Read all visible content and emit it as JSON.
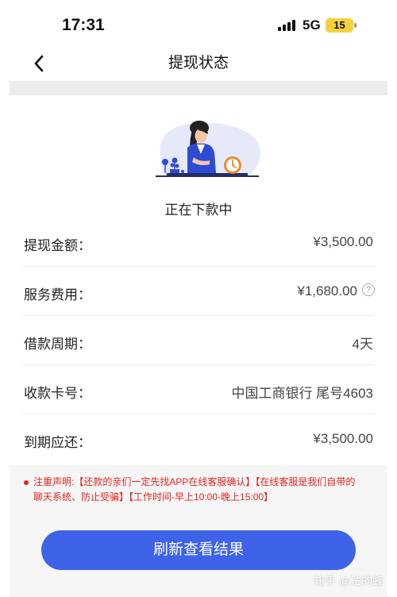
{
  "status_bar": {
    "time": "17:31",
    "network": "5G",
    "battery": "15"
  },
  "nav": {
    "title": "提现状态"
  },
  "status": {
    "text": "正在下款中"
  },
  "rows": [
    {
      "label": "提现金额：",
      "value": "¥3,500.00"
    },
    {
      "label": "服务费用：",
      "value": "¥1,680.00"
    },
    {
      "label": "借款周期：",
      "value": "4天"
    },
    {
      "label": "收款卡号：",
      "value": "中国工商银行  尾号4603"
    },
    {
      "label": "到期应还：",
      "value": "¥3,500.00"
    }
  ],
  "help_glyph": "?",
  "notice": {
    "text": "注重声明:【还款的亲们一定先找APP在线客服确认】【在线客服是我们自带的聊天系统、防止受骗】【工作时间-早上10:00-晚上15:00】",
    "color": "#e0251f"
  },
  "button": {
    "label": "刷新查看结果",
    "color": "#3f63e8"
  },
  "watermark": "知乎 @法的蜂"
}
